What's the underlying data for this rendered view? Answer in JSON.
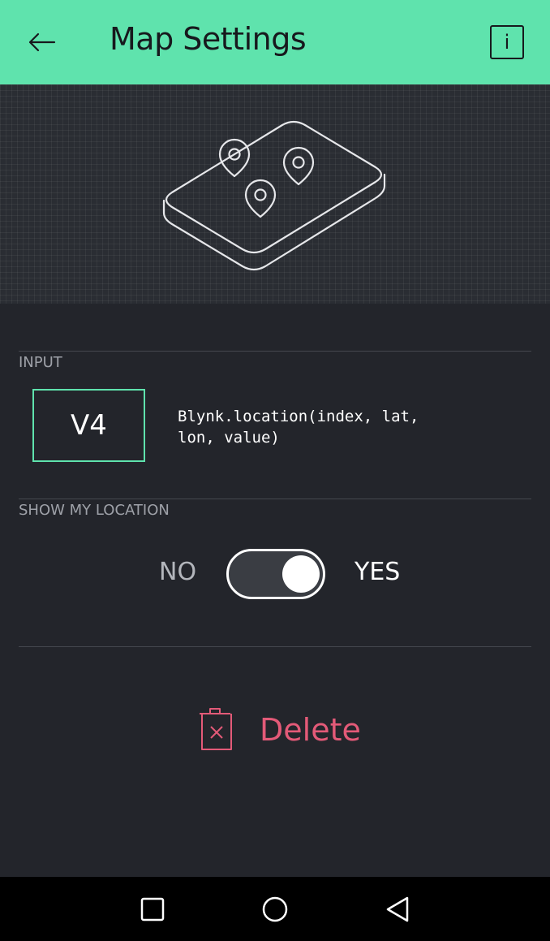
{
  "header": {
    "title": "Map Settings",
    "back_icon": "arrow-left-icon",
    "info_icon": "info-icon",
    "info_label": "i",
    "background_color": "#5fe3ad"
  },
  "hero": {
    "illustration": "map-with-pins-icon"
  },
  "input_section": {
    "label": "INPUT",
    "pin_value": "V4",
    "code_hint": "Blynk.location(index, lat,\nlon, value)",
    "accent_color": "#5fe3ad"
  },
  "location_section": {
    "label": "SHOW MY LOCATION",
    "off_label": "NO",
    "on_label": "YES",
    "enabled": true
  },
  "delete": {
    "label": "Delete",
    "icon": "trash-icon",
    "color": "#e35a78"
  },
  "navbar": {
    "recents_icon": "square-icon",
    "home_icon": "circle-icon",
    "back_icon": "triangle-back-icon"
  }
}
